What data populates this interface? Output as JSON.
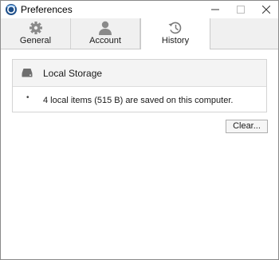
{
  "window": {
    "title": "Preferences",
    "controls": {
      "minimize": "–",
      "maximize": "☐",
      "close": "✕"
    }
  },
  "tabs": [
    {
      "label": "General",
      "icon": "gear-icon",
      "active": false
    },
    {
      "label": "Account",
      "icon": "person-icon",
      "active": false
    },
    {
      "label": "History",
      "icon": "history-icon",
      "active": true
    }
  ],
  "local_storage": {
    "title": "Local Storage",
    "icon": "hard-drive-icon",
    "bullet": "•",
    "info": "4 local items (515 B) are saved on this computer."
  },
  "actions": {
    "clear_label": "Clear..."
  },
  "colors": {
    "icon_gray": "#8a8a8a",
    "app_icon_blue": "#1e4f8a"
  }
}
